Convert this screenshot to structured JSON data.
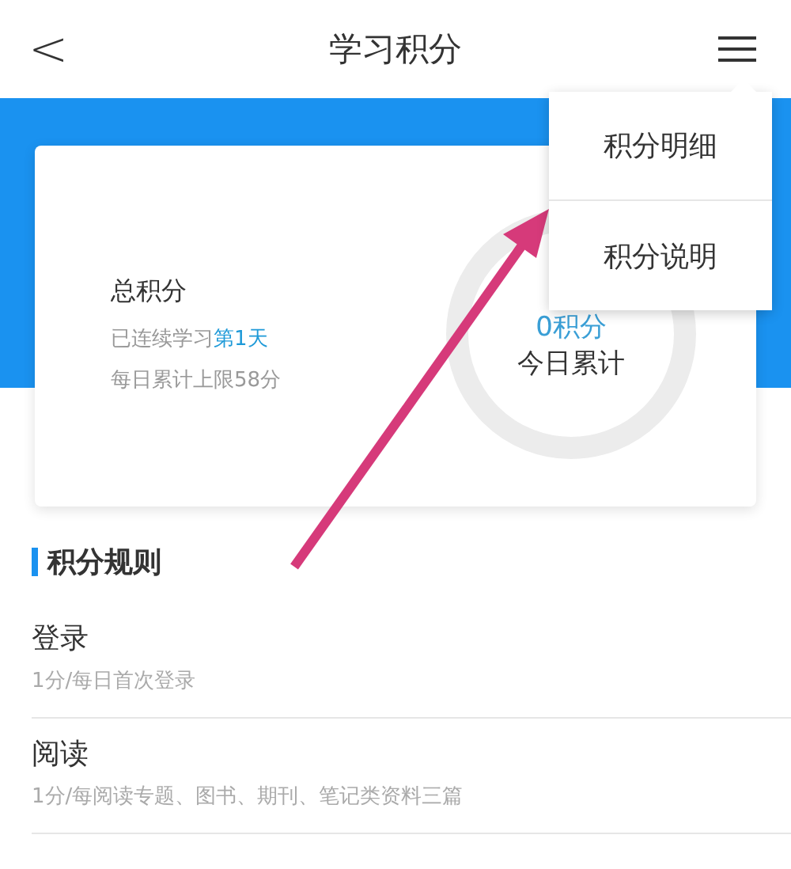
{
  "header": {
    "back": "<",
    "title": "学习积分"
  },
  "summary": {
    "label": "总积分",
    "streak_prefix": "已连续学习",
    "streak_value": "第1天",
    "limit": "每日累计上限58分",
    "today_points": "0积分",
    "today_label": "今日累计"
  },
  "menu": {
    "open": true,
    "items": [
      "积分明细",
      "积分说明"
    ]
  },
  "rules": {
    "title": "积分规则",
    "items": [
      {
        "name": "登录",
        "detail": "1分/每日首次登录"
      },
      {
        "name": "阅读",
        "detail": "1分/每阅读专题、图书、期刊、笔记类资料三篇"
      }
    ]
  }
}
